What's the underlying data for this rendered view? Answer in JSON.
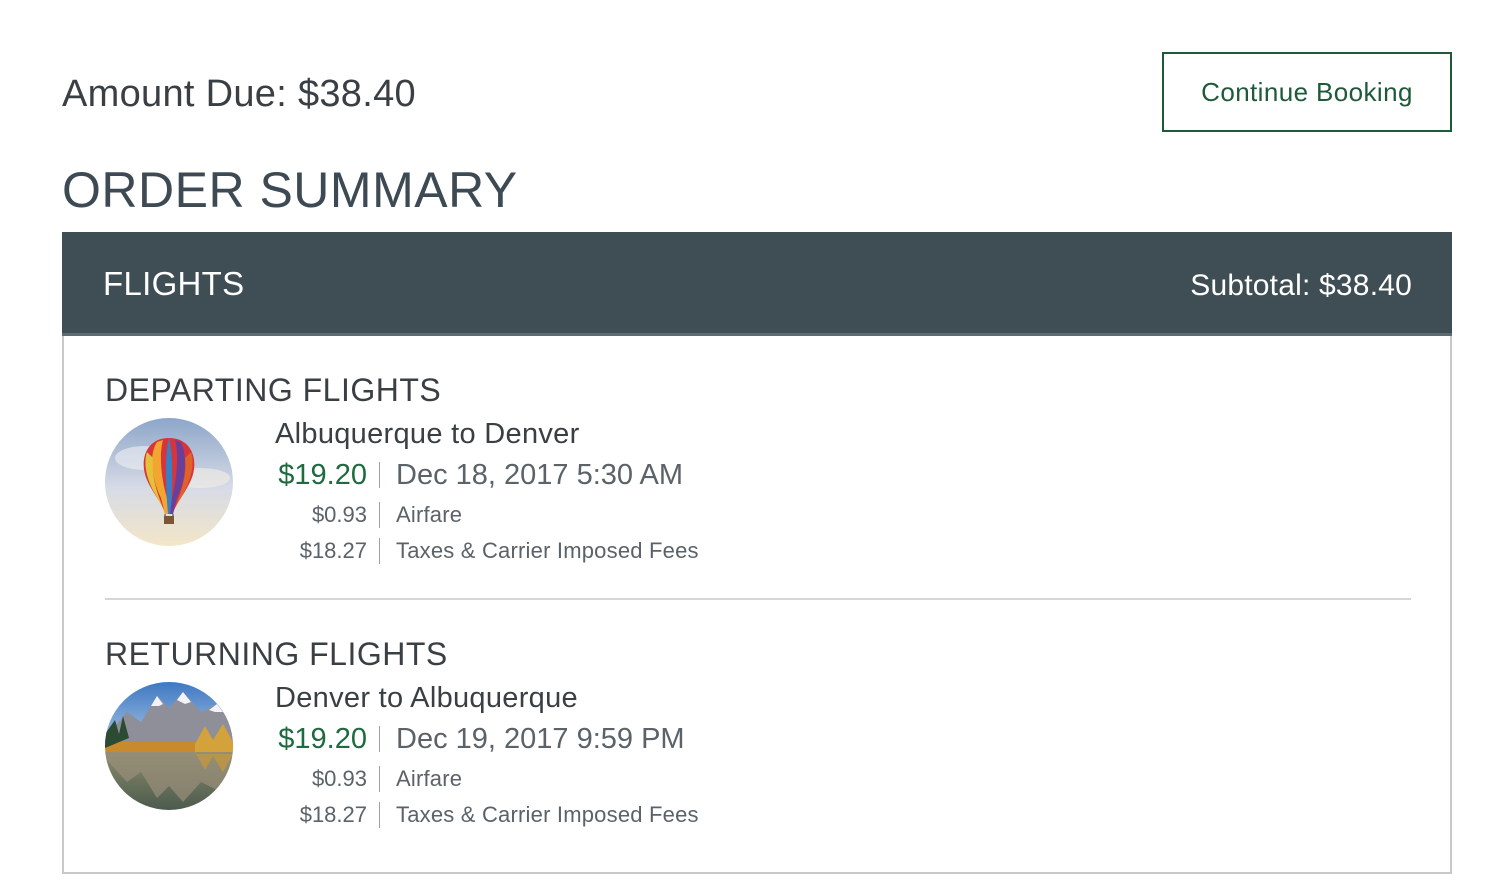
{
  "amount_due": "Amount Due: $38.40",
  "continue_button": "Continue Booking",
  "order_summary_title": "ORDER SUMMARY",
  "flights": {
    "header_label": "FLIGHTS",
    "subtotal": "Subtotal: $38.40",
    "departing": {
      "section_title": "DEPARTING FLIGHTS",
      "image_icon": "hot-air-balloon-image",
      "route": "Albuquerque to Denver",
      "price": "$19.20",
      "datetime": "Dec 18, 2017 5:30 AM",
      "airfare_amount": "$0.93",
      "airfare_label": "Airfare",
      "taxes_amount": "$18.27",
      "taxes_label": "Taxes & Carrier Imposed Fees"
    },
    "returning": {
      "section_title": "RETURNING FLIGHTS",
      "image_icon": "mountain-lake-image",
      "route": "Denver to Albuquerque",
      "price": "$19.20",
      "datetime": "Dec 19, 2017 9:59 PM",
      "airfare_amount": "$0.93",
      "airfare_label": "Airfare",
      "taxes_amount": "$18.27",
      "taxes_label": "Taxes & Carrier Imposed Fees"
    }
  },
  "colors": {
    "accent_green": "#1e5a3a",
    "price_green": "#1e6b3f",
    "header_bg": "#3f4d55",
    "text_dark": "#3a3f44"
  }
}
